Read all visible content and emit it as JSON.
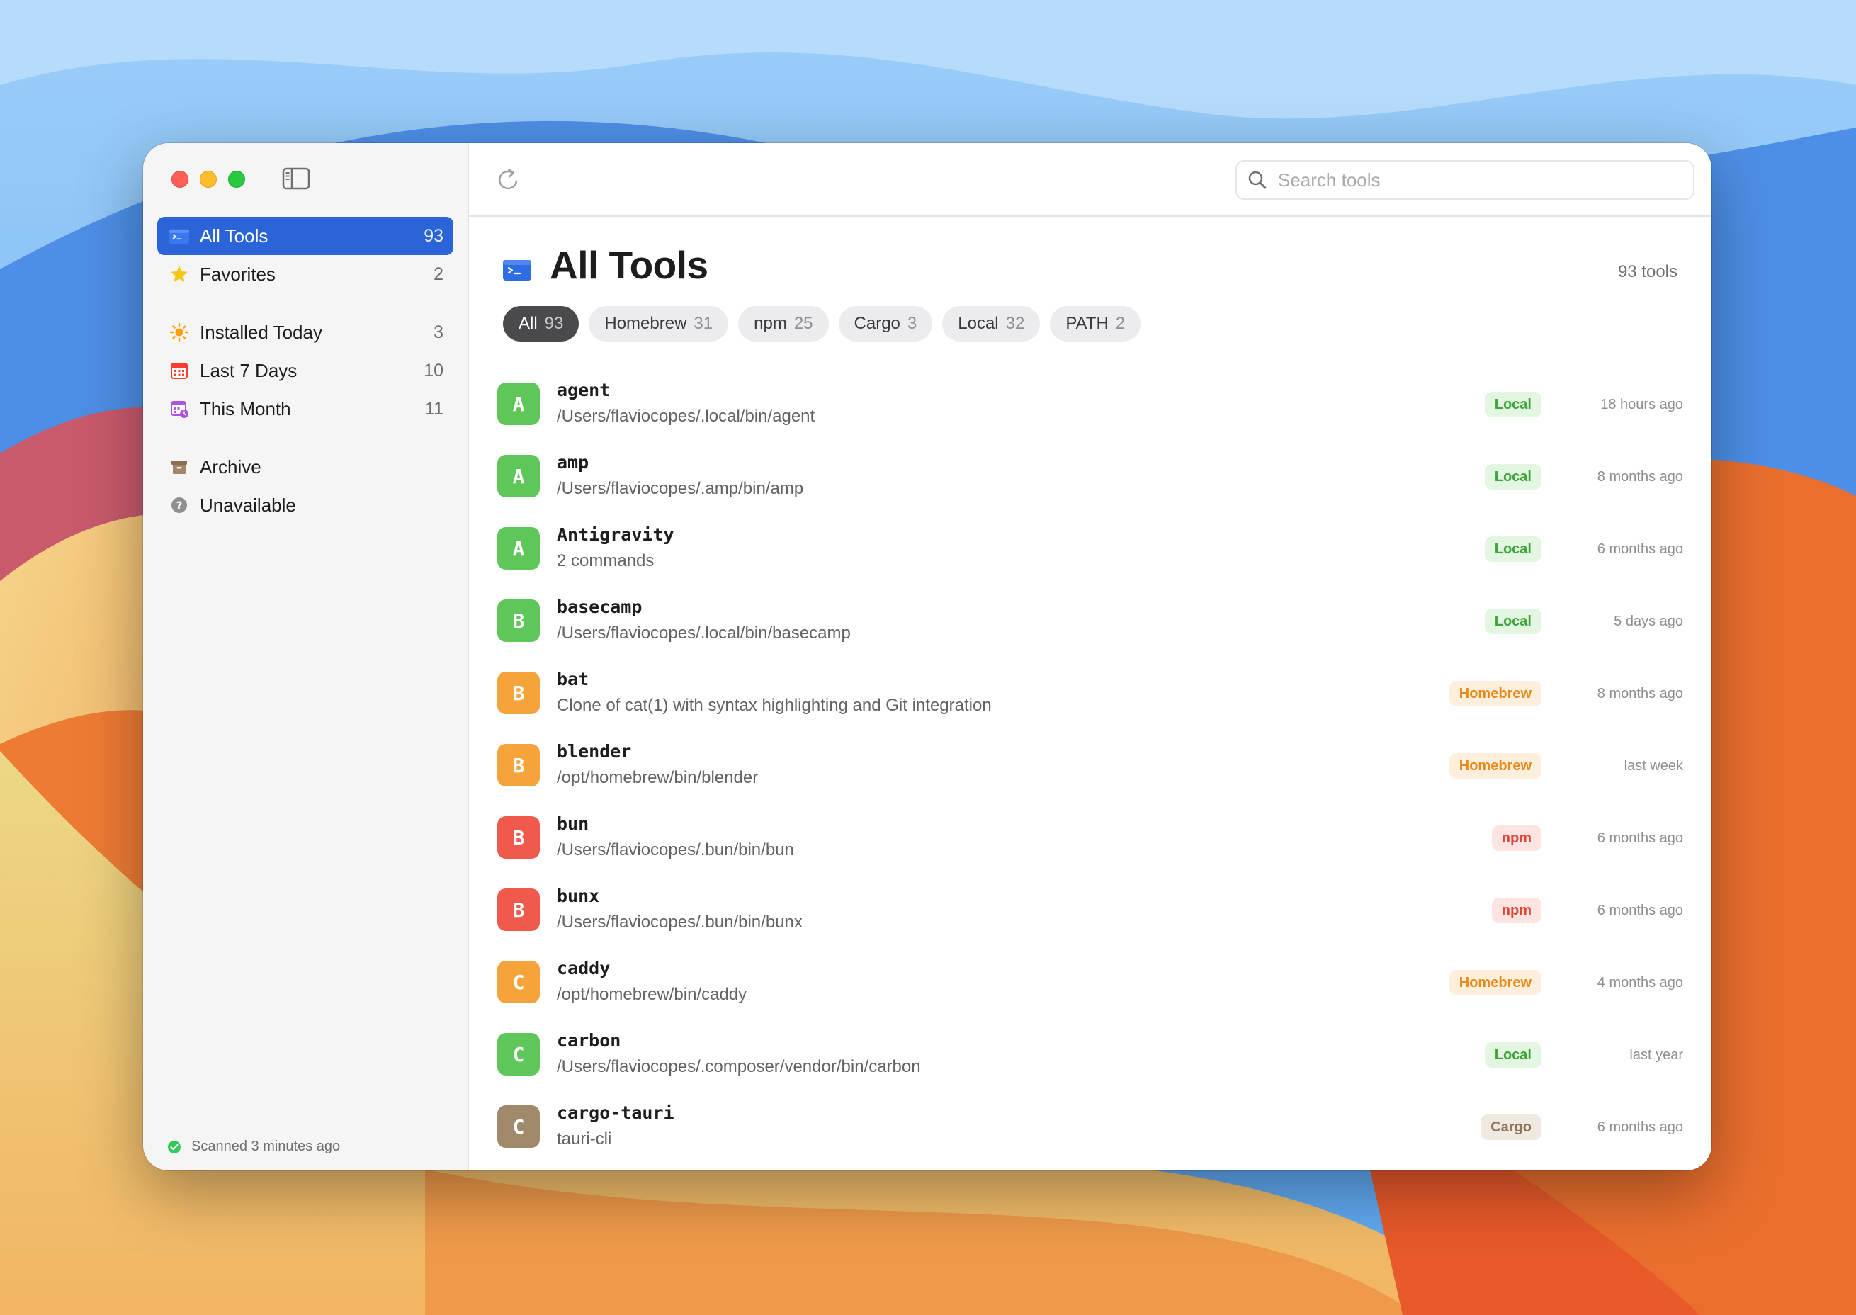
{
  "window": {
    "sidebar": {
      "nav_groups": [
        [
          {
            "id": "all",
            "label": "All Tools",
            "count": "93",
            "active": true,
            "icon": "terminal-folder-icon"
          },
          {
            "id": "favorites",
            "label": "Favorites",
            "count": "2",
            "active": false,
            "icon": "star-icon"
          }
        ],
        [
          {
            "id": "installed-today",
            "label": "Installed Today",
            "count": "3",
            "active": false,
            "icon": "sun-icon"
          },
          {
            "id": "last-7-days",
            "label": "Last 7 Days",
            "count": "10",
            "active": false,
            "icon": "calendar-icon"
          },
          {
            "id": "this-month",
            "label": "This Month",
            "count": "11",
            "active": false,
            "icon": "calendar-clock-icon"
          }
        ],
        [
          {
            "id": "archive",
            "label": "Archive",
            "count": "",
            "active": false,
            "icon": "archive-box-icon"
          },
          {
            "id": "unavailable",
            "label": "Unavailable",
            "count": "",
            "active": false,
            "icon": "question-circle-icon"
          }
        ]
      ],
      "scan_status": "Scanned 3 minutes ago"
    },
    "toolbar": {
      "search_placeholder": "Search tools",
      "search_value": ""
    },
    "main": {
      "title": "All Tools",
      "tool_count": "93 tools",
      "filters": [
        {
          "label": "All",
          "count": "93",
          "active": true
        },
        {
          "label": "Homebrew",
          "count": "31",
          "active": false
        },
        {
          "label": "npm",
          "count": "25",
          "active": false
        },
        {
          "label": "Cargo",
          "count": "3",
          "active": false
        },
        {
          "label": "Local",
          "count": "32",
          "active": false
        },
        {
          "label": "PATH",
          "count": "2",
          "active": false
        }
      ],
      "tools": [
        {
          "letter": "A",
          "name": "agent",
          "subtitle": "/Users/flaviocopes/.local/bin/agent",
          "source": "Local",
          "time": "18 hours ago"
        },
        {
          "letter": "A",
          "name": "amp",
          "subtitle": "/Users/flaviocopes/.amp/bin/amp",
          "source": "Local",
          "time": "8 months ago"
        },
        {
          "letter": "A",
          "name": "Antigravity",
          "subtitle": "2 commands",
          "source": "Local",
          "time": "6 months ago"
        },
        {
          "letter": "B",
          "name": "basecamp",
          "subtitle": "/Users/flaviocopes/.local/bin/basecamp",
          "source": "Local",
          "time": "5 days ago"
        },
        {
          "letter": "B",
          "name": "bat",
          "subtitle": "Clone of cat(1) with syntax highlighting and Git integration",
          "source": "Homebrew",
          "time": "8 months ago"
        },
        {
          "letter": "B",
          "name": "blender",
          "subtitle": "/opt/homebrew/bin/blender",
          "source": "Homebrew",
          "time": "last week"
        },
        {
          "letter": "B",
          "name": "bun",
          "subtitle": "/Users/flaviocopes/.bun/bin/bun",
          "source": "npm",
          "time": "6 months ago"
        },
        {
          "letter": "B",
          "name": "bunx",
          "subtitle": "/Users/flaviocopes/.bun/bin/bunx",
          "source": "npm",
          "time": "6 months ago"
        },
        {
          "letter": "C",
          "name": "caddy",
          "subtitle": "/opt/homebrew/bin/caddy",
          "source": "Homebrew",
          "time": "4 months ago"
        },
        {
          "letter": "C",
          "name": "carbon",
          "subtitle": "/Users/flaviocopes/.composer/vendor/bin/carbon",
          "source": "Local",
          "time": "last year"
        },
        {
          "letter": "C",
          "name": "cargo-tauri",
          "subtitle": "tauri-cli",
          "source": "Cargo",
          "time": "6 months ago"
        }
      ]
    },
    "source_colors": {
      "Local": {
        "avatar": "#5fc75a",
        "badge_bg": "#e3f6e1",
        "badge_fg": "#3ea53a"
      },
      "Homebrew": {
        "avatar": "#f5a43b",
        "badge_bg": "#fdefdc",
        "badge_fg": "#e88a1a"
      },
      "npm": {
        "avatar": "#ef5a4c",
        "badge_bg": "#fde4e1",
        "badge_fg": "#e0463a"
      },
      "Cargo": {
        "avatar": "#a18a6c",
        "badge_bg": "#efe9e1",
        "badge_fg": "#8b7455"
      },
      "PATH": {
        "avatar": "#8e8e93",
        "badge_bg": "#ececee",
        "badge_fg": "#6e6e73"
      }
    },
    "accent_color": "#2b63d9"
  }
}
